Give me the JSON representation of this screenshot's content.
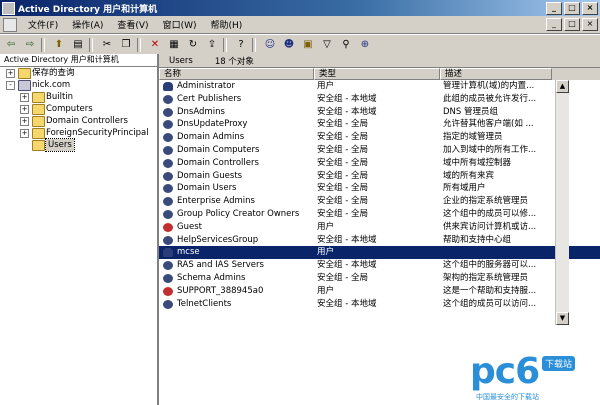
{
  "window": {
    "title": "Active Directory 用户和计算机"
  },
  "menu": {
    "items": [
      "文件(F)",
      "操作(A)",
      "查看(V)",
      "窗口(W)",
      "帮助(H)"
    ]
  },
  "toolbar": {
    "icons": [
      "back-icon",
      "forward-icon",
      "up-icon",
      "show-tree-icon",
      "cut-icon",
      "copy-icon",
      "delete-icon",
      "properties-icon",
      "refresh-icon",
      "export-icon",
      "help-icon",
      "new-user-icon",
      "new-group-icon",
      "new-ou-icon",
      "filter-icon",
      "find-icon",
      "add-to-group-icon"
    ]
  },
  "tree": {
    "header": "Active Directory 用户和计算机",
    "nodes": [
      {
        "label": "保存的查询",
        "depth": 1,
        "expander": "+"
      },
      {
        "label": "nick.com",
        "depth": 1,
        "expander": "-"
      },
      {
        "label": "Builtin",
        "depth": 2,
        "expander": "+"
      },
      {
        "label": "Computers",
        "depth": 2,
        "expander": "+"
      },
      {
        "label": "Domain Controllers",
        "depth": 2,
        "expander": "+"
      },
      {
        "label": "ForeignSecurityPrincipal",
        "depth": 2,
        "expander": "+"
      },
      {
        "label": "Users",
        "depth": 2,
        "expander": ""
      }
    ]
  },
  "list": {
    "folder": "Users",
    "count": "18 个对象",
    "columns": [
      "名称",
      "类型",
      "描述"
    ],
    "rows": [
      {
        "name": "Administrator",
        "type": "用户",
        "desc": "管理计算机(域)的内置...",
        "icon": "user-icon"
      },
      {
        "name": "Cert Publishers",
        "type": "安全组 - 本地域",
        "desc": "此组的成员被允许发行...",
        "icon": "group-icon"
      },
      {
        "name": "DnsAdmins",
        "type": "安全组 - 本地域",
        "desc": "DNS 管理员组",
        "icon": "group-icon"
      },
      {
        "name": "DnsUpdateProxy",
        "type": "安全组 - 全局",
        "desc": "允许替其他客户端(如 ...",
        "icon": "group-icon"
      },
      {
        "name": "Domain Admins",
        "type": "安全组 - 全局",
        "desc": "指定的域管理员",
        "icon": "group-icon"
      },
      {
        "name": "Domain Computers",
        "type": "安全组 - 全局",
        "desc": "加入到域中的所有工作...",
        "icon": "group-icon"
      },
      {
        "name": "Domain Controllers",
        "type": "安全组 - 全局",
        "desc": "域中所有域控制器",
        "icon": "group-icon"
      },
      {
        "name": "Domain Guests",
        "type": "安全组 - 全局",
        "desc": "域的所有来宾",
        "icon": "group-icon"
      },
      {
        "name": "Domain Users",
        "type": "安全组 - 全局",
        "desc": "所有域用户",
        "icon": "group-icon"
      },
      {
        "name": "Enterprise Admins",
        "type": "安全组 - 全局",
        "desc": "企业的指定系统管理员",
        "icon": "group-icon"
      },
      {
        "name": "Group Policy Creator Owners",
        "type": "安全组 - 全局",
        "desc": "这个组中的成员可以修...",
        "icon": "group-icon"
      },
      {
        "name": "Guest",
        "type": "用户",
        "desc": "供来宾访问计算机或访...",
        "icon": "disabled-user-icon"
      },
      {
        "name": "HelpServicesGroup",
        "type": "安全组 - 本地域",
        "desc": "帮助和支持中心组",
        "icon": "group-icon"
      },
      {
        "name": "mcse",
        "type": "用户",
        "desc": "",
        "icon": "user-icon",
        "selected": true
      },
      {
        "name": "RAS and IAS Servers",
        "type": "安全组 - 本地域",
        "desc": "这个组中的服务器可以...",
        "icon": "group-icon"
      },
      {
        "name": "Schema Admins",
        "type": "安全组 - 全局",
        "desc": "架构的指定系统管理员",
        "icon": "group-icon"
      },
      {
        "name": "SUPPORT_388945a0",
        "type": "用户",
        "desc": "这是一个帮助和支持服...",
        "icon": "disabled-user-icon"
      },
      {
        "name": "TelnetClients",
        "type": "安全组 - 本地域",
        "desc": "这个组的成员可以访问...",
        "icon": "group-icon"
      }
    ]
  },
  "watermark": {
    "logo": "pc6",
    "tag": "下载站",
    "sub": "中国最安全的下载站"
  },
  "colors": {
    "title_start": "#0a246a",
    "title_end": "#a6caf0",
    "selection": "#0a246a",
    "watermark": "#2a8fd8"
  }
}
